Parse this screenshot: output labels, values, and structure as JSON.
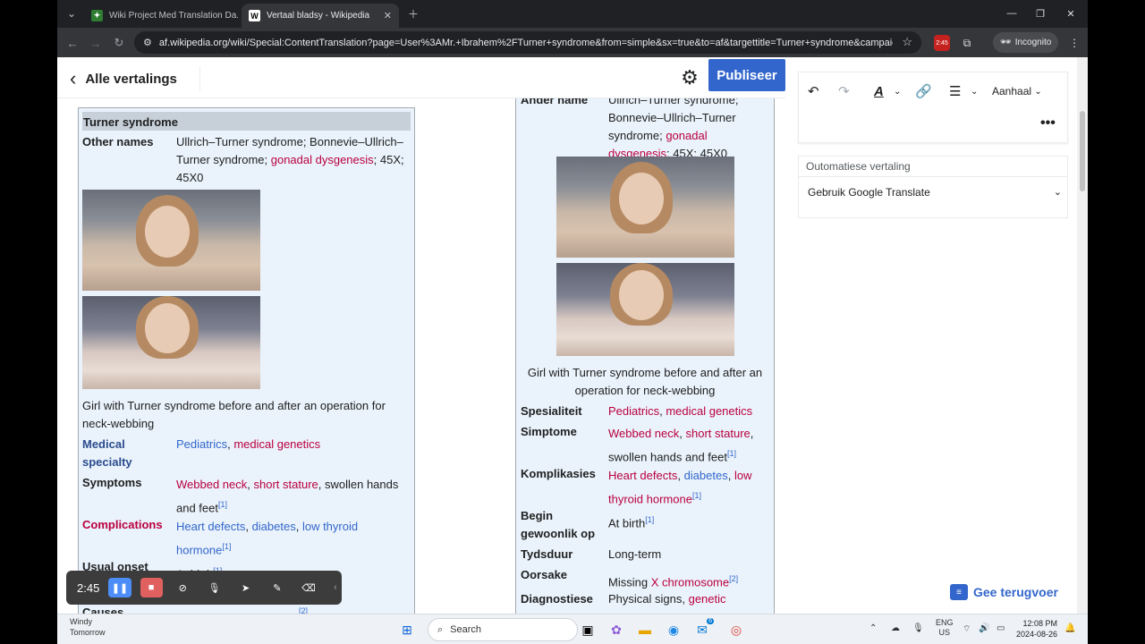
{
  "tabs": [
    {
      "label": "Wiki Project Med Translation Da..."
    },
    {
      "label": "Vertaal bladsy - Wikipedia"
    }
  ],
  "address": "af.wikipedia.org/wiki/Special:ContentTranslation?page=User%3AMr.+Ibrahem%2FTurner+syndrome&from=simple&sx=true&to=af&targettitle=Turner+syndrome&campaign...",
  "incognito": "Incognito",
  "ext_badge": "2:45",
  "header": {
    "back_label": "Alle vertalings",
    "publish_label": "Publiseer"
  },
  "source": {
    "title": "Turner syndrome",
    "other_names_label": "Other names",
    "other_names_text1": "Ullrich–Turner syndrome; Bonnevie–Ullrich–",
    "other_names_text2a": "Turner syndrome; ",
    "other_names_link": "gonadal dysgenesis",
    "other_names_text2b": "; 45X;",
    "other_names_text3": "45X0",
    "caption1": "Girl with Turner syndrome before and after an operation for",
    "caption2": "neck-webbing",
    "specialty_label1": "Medical",
    "specialty_label2": "specialty",
    "specialty_v1": "Pediatrics",
    "specialty_v2": "medical genetics",
    "symptoms_label": "Symptoms",
    "symptoms_v1": "Webbed neck",
    "symptoms_v2": "short stature",
    "symptoms_v3": ", swollen hands",
    "symptoms_v4": "and feet",
    "complications_label": "Complications",
    "comp_v1": "Heart defects",
    "comp_v2": "diabetes",
    "comp_v3": "low thyroid",
    "comp_v4": "hormone",
    "onset_label": "Usual onset",
    "onset_v": "At birth",
    "causes_label": "Causes",
    "ref": "[1]",
    "ref2": "[2]"
  },
  "target": {
    "other_label": "Ander name",
    "other_text1": "Ullrich–Turner syndrome;",
    "other_text2": "Bonnevie–Ullrich–Turner",
    "other_text3a": "syndrome; ",
    "other_link1": "gonadal",
    "other_link2": "dysgenesis",
    "other_text4": "; 45X; 45X0",
    "caption1": "Girl with Turner syndrome before and after an",
    "caption2": "operation for neck-webbing",
    "spec_label": "Spesialiteit",
    "spec_v1": "Pediatrics",
    "spec_v2": "medical genetics",
    "symp_label": "Simptome",
    "symp_v1": "Webbed neck",
    "symp_v2": "short stature",
    "symp_v3": "swollen hands and feet",
    "komp_label": "Komplikasies",
    "komp_v1": "Heart defects",
    "komp_v2": "diabetes",
    "komp_v3": "low",
    "komp_v4": "thyroid hormone",
    "begin_label1": "Begin",
    "begin_label2": "gewoonlik op",
    "begin_v": "At birth",
    "duur_label": "Tydsduur",
    "duur_v": "Long-term",
    "oorsake_label": "Oorsake",
    "oorsake_v1": "Missing ",
    "oorsake_v2": "X chromosome",
    "diag_label": "Diagnostiese",
    "diag_v1": "Physical signs, ",
    "diag_v2": "genetic"
  },
  "panel": {
    "style_label": "Aanhaal",
    "mt_label": "Outomatiese vertaling",
    "mt_value": "Gebruik Google Translate"
  },
  "feedback": "Gee terugvoer",
  "recorder": {
    "time": "2:45"
  },
  "taskbar": {
    "weather1": "Windy",
    "weather2": "Tomorrow",
    "search": "Search",
    "lang1": "ENG",
    "lang2": "US",
    "time": "12:08 PM",
    "date": "2024-08-26",
    "notif": "6"
  },
  "colors": {
    "accent": "#3366cc",
    "link_red": "#ba0040",
    "link_blue": "#3366cc"
  }
}
